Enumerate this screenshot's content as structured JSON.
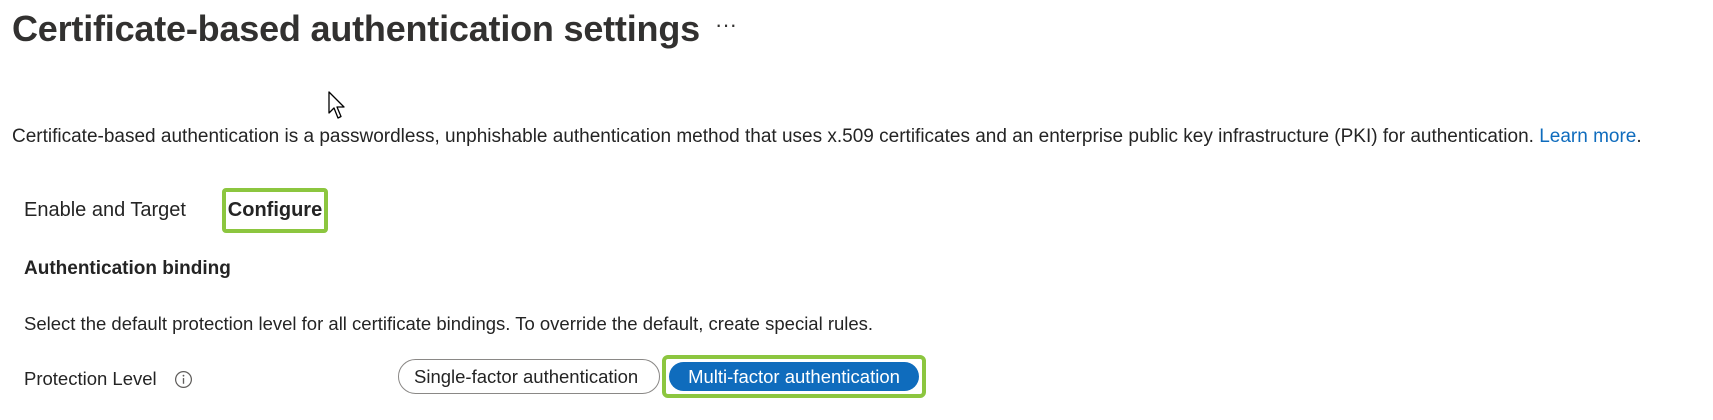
{
  "header": {
    "title": "Certificate-based authentication settings",
    "more_label": "···"
  },
  "description": {
    "text": "Certificate-based authentication is a passwordless, unphishable authentication method that uses x.509 certificates and an enterprise public key infrastructure (PKI) for authentication.",
    "link": "Learn more",
    "trailing": "."
  },
  "tabs": [
    {
      "label": "Enable and Target",
      "selected": false
    },
    {
      "label": "Configure",
      "selected": true
    }
  ],
  "section": {
    "heading": "Authentication binding",
    "instructions": "Select the default protection level for all certificate bindings. To override the default, create special rules."
  },
  "protection_level": {
    "label": "Protection Level",
    "info_icon": "info-icon",
    "options": [
      {
        "label": "Single-factor authentication",
        "selected": false
      },
      {
        "label": "Multi-factor authentication",
        "selected": true
      }
    ]
  },
  "colors": {
    "accent": "#0f6cbd",
    "highlight": "#8cc63f",
    "text": "#242424"
  }
}
